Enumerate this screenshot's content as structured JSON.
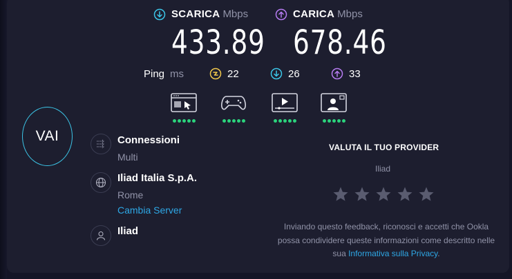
{
  "download": {
    "label": "SCARICA",
    "unit": "Mbps",
    "value": "433.89",
    "icon": "arrow-down-circle-icon",
    "color": "#3cc6e8"
  },
  "upload": {
    "label": "CARICA",
    "unit": "Mbps",
    "value": "678.46",
    "icon": "arrow-up-circle-icon",
    "color": "#b77cf2"
  },
  "ping": {
    "label": "Ping",
    "unit": "ms",
    "idle": {
      "value": "22",
      "icon": "ping-idle-icon",
      "color": "#f2c94c"
    },
    "download": {
      "value": "26",
      "icon": "arrow-down-circle-icon",
      "color": "#3cc6e8"
    },
    "upload": {
      "value": "33",
      "icon": "arrow-up-circle-icon",
      "color": "#b77cf2"
    }
  },
  "activities": [
    {
      "icon": "web-browsing-icon",
      "rating": 5
    },
    {
      "icon": "gaming-icon",
      "rating": 5
    },
    {
      "icon": "video-streaming-icon",
      "rating": 5
    },
    {
      "icon": "video-call-icon",
      "rating": 5
    }
  ],
  "go_button": {
    "label": "VAI"
  },
  "connections": {
    "title": "Connessioni",
    "value": "Multi",
    "icon": "connections-icon"
  },
  "server": {
    "name": "Iliad Italia S.p.A.",
    "location": "Rome",
    "change_label": "Cambia Server",
    "icon": "globe-icon"
  },
  "provider": {
    "name": "Iliad",
    "icon": "user-icon"
  },
  "rating": {
    "title": "VALUTA IL TUO PROVIDER",
    "provider": "Iliad",
    "stars": 5,
    "star_color": "#5a5c70",
    "disclaimer_text": "Inviando questo feedback, riconosci e accetti che Ookla possa condividere queste informazioni come descritto nelle sua ",
    "privacy_link": "Informativa sulla Privacy",
    "disclaimer_end": "."
  },
  "colors": {
    "background": "#1d1e2f",
    "accent_link": "#2ea8e6",
    "rating_dot": "#2bd37c"
  }
}
